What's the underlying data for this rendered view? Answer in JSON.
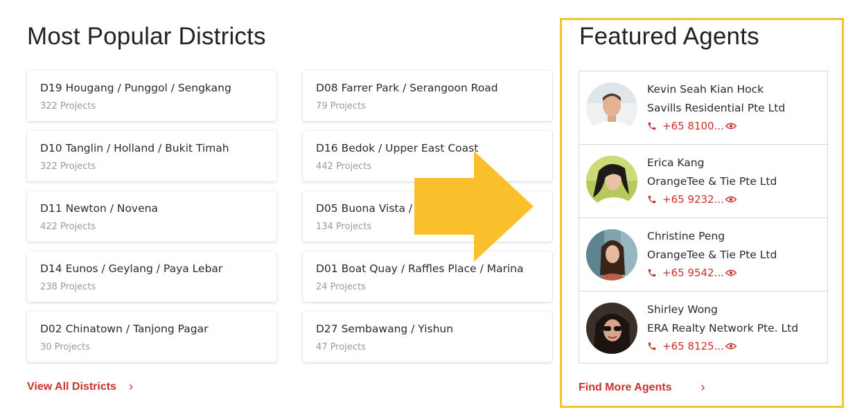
{
  "districts": {
    "title": "Most Popular Districts",
    "items": [
      {
        "name": "D19 Hougang / Punggol / Sengkang",
        "count": "322 Projects"
      },
      {
        "name": "D08 Farrer Park / Serangoon Road",
        "count": "79 Projects"
      },
      {
        "name": "D10 Tanglin / Holland / Bukit Timah",
        "count": "322 Projects"
      },
      {
        "name": "D16 Bedok / Upper East Coast",
        "count": "442 Projects"
      },
      {
        "name": "D11 Newton / Novena",
        "count": "422 Projects"
      },
      {
        "name": "D05 Buona Vista / ...",
        "count": "134 Projects"
      },
      {
        "name": "D14 Eunos / Geylang / Paya Lebar",
        "count": "238 Projects"
      },
      {
        "name": "D01 Boat Quay / Raffles Place / Marina",
        "count": "24 Projects"
      },
      {
        "name": "D02 Chinatown / Tanjong Pagar",
        "count": "30 Projects"
      },
      {
        "name": "D27 Sembawang / Yishun",
        "count": "47 Projects"
      }
    ],
    "view_all_label": "View All Districts"
  },
  "agents": {
    "title": "Featured Agents",
    "items": [
      {
        "name": "Kevin Seah Kian Hock",
        "agency": "Savills Residential Pte Ltd",
        "phone": "+65 8100..."
      },
      {
        "name": "Erica Kang",
        "agency": "OrangeTee & Tie Pte Ltd",
        "phone": "+65 9232..."
      },
      {
        "name": "Christine Peng",
        "agency": "OrangeTee & Tie Pte Ltd",
        "phone": "+65 9542..."
      },
      {
        "name": "Shirley Wong",
        "agency": "ERA Realty Network Pte. Ltd",
        "phone": "+65 8125..."
      }
    ],
    "find_more_label": "Find More Agents"
  },
  "icons": {
    "chevron": "chevron-right-icon",
    "phone": "phone-icon",
    "reveal": "eye-icon",
    "overlay": "arrow-right-icon"
  },
  "colors": {
    "accent": "#c9302c",
    "highlight": "#f5c22b",
    "arrow": "#f9c02b",
    "muted_text": "#999999",
    "border": "#d6d6d6"
  }
}
